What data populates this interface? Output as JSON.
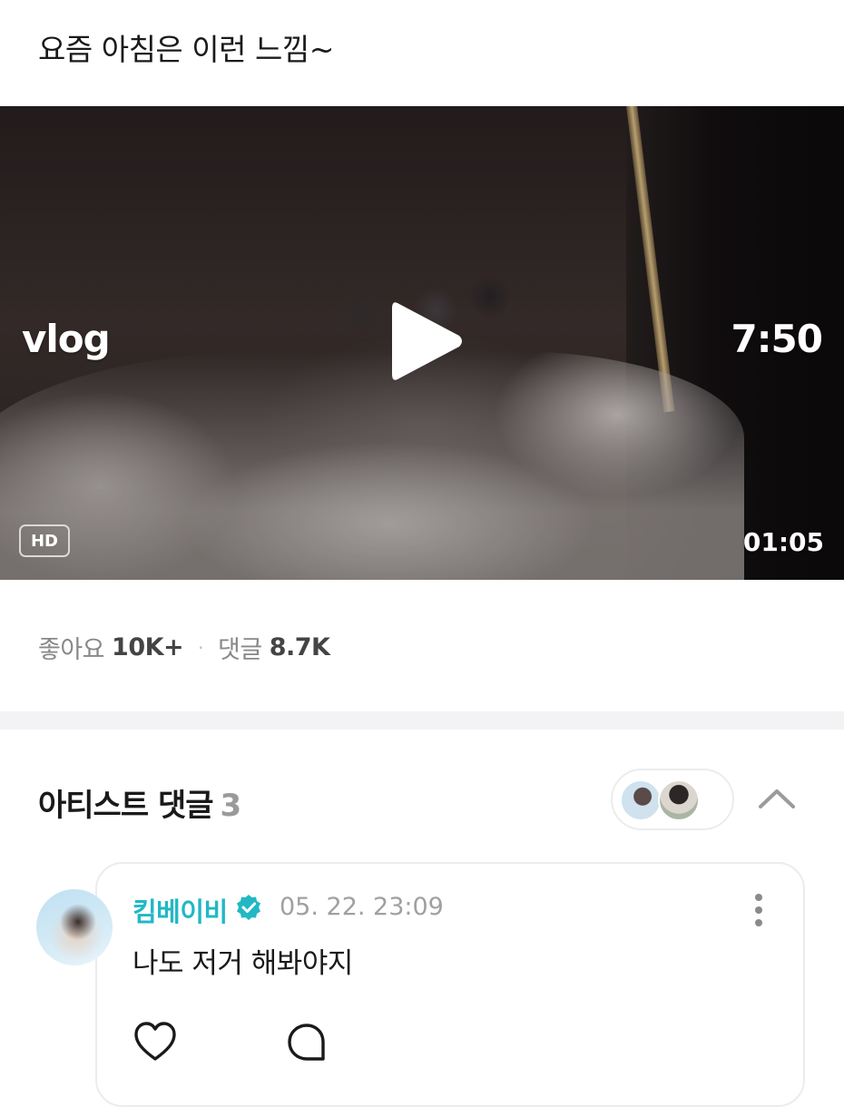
{
  "post": {
    "caption": "요즘 아침은 이런 느낌~"
  },
  "video": {
    "overlay_left": "vlog",
    "overlay_right": "7:50",
    "quality_badge": "HD",
    "duration": "01:05"
  },
  "stats": {
    "likes_label": "좋아요",
    "likes_count": "10K+",
    "separator": "·",
    "comments_label": "댓글",
    "comments_count": "8.7K"
  },
  "artist_comments": {
    "title": "아티스트 댓글",
    "count": "3"
  },
  "comment": {
    "author": "킴베이비",
    "timestamp": "05. 22. 23:09",
    "text": "나도 저거 해봐야지"
  },
  "colors": {
    "accent": "#21b8c4",
    "muted_text": "#888888",
    "divider": "#f3f3f5"
  },
  "icons": [
    "play-icon",
    "verified-badge-icon",
    "chevron-up-icon",
    "more-vertical-icon",
    "heart-icon",
    "comment-bubble-icon"
  ]
}
